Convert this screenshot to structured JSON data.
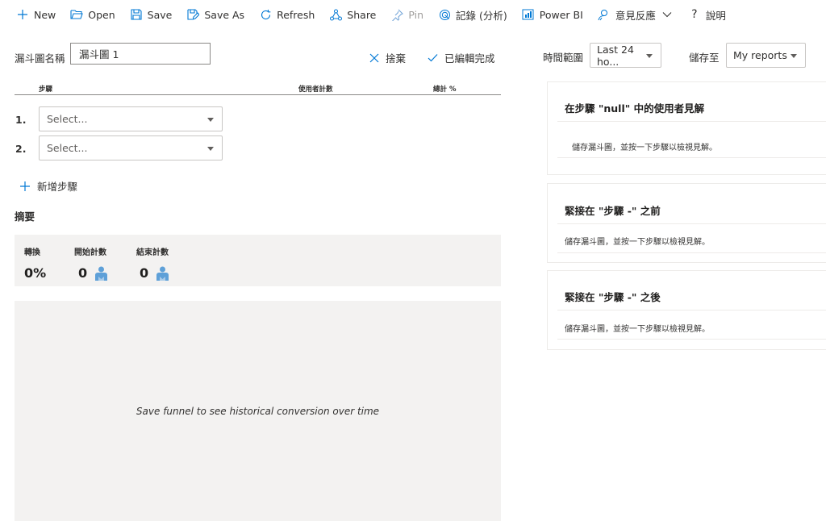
{
  "toolbar": {
    "new": "New",
    "open": "Open",
    "save": "Save",
    "save_as": "Save As",
    "refresh": "Refresh",
    "share": "Share",
    "pin": "Pin",
    "logs": "記錄 (分析)",
    "power_bi": "Power BI",
    "feedback": "意見反應",
    "help": "說明"
  },
  "funnel": {
    "name_label": "漏斗圖名稱",
    "name_value": "漏斗圖 1",
    "discard_label": "捨棄",
    "done_label": "已編輯完成"
  },
  "time_range": {
    "label": "時間範圍",
    "value": "Last 24 ho..."
  },
  "save_to": {
    "label": "儲存至",
    "value": "My reports"
  },
  "steps": {
    "headers": {
      "step": "步驟",
      "user_count": "使用者計數",
      "total_pct": "總計 %"
    },
    "items": [
      {
        "number": "1.",
        "placeholder": "Select..."
      },
      {
        "number": "2.",
        "placeholder": "Select..."
      }
    ],
    "add_label": "新增步驟"
  },
  "summary": {
    "title": "摘要",
    "conversion_label": "轉換",
    "conversion_value": "0%",
    "start_label": "開始計數",
    "start_value": "0",
    "end_label": "結束計數",
    "end_value": "0"
  },
  "chart_message": "Save funnel to see historical conversion over time",
  "insights": [
    {
      "title": "在步驟 \"null\" 中的使用者見解",
      "body": "儲存漏斗圖，並按一下步驟以檢視見解。"
    },
    {
      "title": "緊接在 \"步驟 -\" 之前",
      "body": "儲存漏斗圖，並按一下步驟以檢視見解。"
    },
    {
      "title": "緊接在 \"步驟 -\" 之後",
      "body": "儲存漏斗圖，並按一下步驟以檢視見解。"
    }
  ],
  "colors": {
    "accent": "#0078d4",
    "user_icon": "#5ea0d8",
    "panel_bg": "#f3f2f1"
  }
}
